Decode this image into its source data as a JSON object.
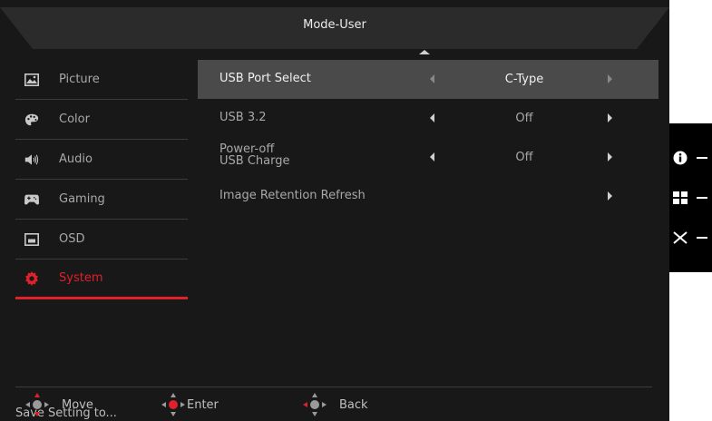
{
  "header": {
    "title": "Mode-User"
  },
  "sidebar": {
    "items": [
      {
        "label": "Picture",
        "icon": "picture-icon"
      },
      {
        "label": "Color",
        "icon": "palette-icon"
      },
      {
        "label": "Audio",
        "icon": "speaker-icon"
      },
      {
        "label": "Gaming",
        "icon": "gamepad-icon"
      },
      {
        "label": "OSD",
        "icon": "osd-icon"
      },
      {
        "label": "System",
        "icon": "gear-icon",
        "active": true
      }
    ],
    "save_label": "Save Setting to..."
  },
  "main": {
    "rows": [
      {
        "label": "USB Port Select",
        "value": "C-Type",
        "selected": true
      },
      {
        "label": "USB 3.2",
        "value": "Off"
      },
      {
        "label_line1": "Power-off",
        "label_line2": "USB Charge",
        "value": "Off"
      },
      {
        "label": "Image Retention Refresh",
        "value": ""
      }
    ]
  },
  "footer": {
    "move_label": "Move",
    "enter_label": "Enter",
    "back_label": "Back"
  },
  "keys": [
    "info-icon",
    "grid-icon",
    "close-icon"
  ],
  "colors": {
    "accent": "#e0202a",
    "background": "#181818",
    "selected_row": "#4a4a4a"
  }
}
